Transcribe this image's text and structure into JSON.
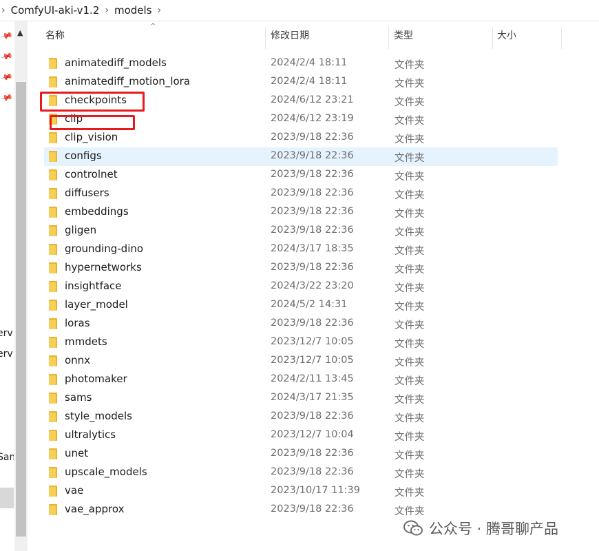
{
  "breadcrumb": {
    "items": [
      "ComfyUI-aki-v1.2",
      "models"
    ]
  },
  "nav_pane": {
    "partial_labels": [
      "erv",
      "erv",
      "Sam"
    ]
  },
  "columns": {
    "name": "名称",
    "date": "修改日期",
    "type": "类型",
    "size": "大小"
  },
  "rows": [
    {
      "name": "animatediff_models",
      "date": "2024/2/4 18:11",
      "type": "文件夹"
    },
    {
      "name": "animatediff_motion_lora",
      "date": "2024/2/4 18:11",
      "type": "文件夹"
    },
    {
      "name": "checkpoints",
      "date": "2024/6/12 23:21",
      "type": "文件夹"
    },
    {
      "name": "clip",
      "date": "2024/6/12 23:19",
      "type": "文件夹"
    },
    {
      "name": "clip_vision",
      "date": "2023/9/18 22:36",
      "type": "文件夹"
    },
    {
      "name": "configs",
      "date": "2023/9/18 22:36",
      "type": "文件夹"
    },
    {
      "name": "controlnet",
      "date": "2023/9/18 22:36",
      "type": "文件夹"
    },
    {
      "name": "diffusers",
      "date": "2023/9/18 22:36",
      "type": "文件夹"
    },
    {
      "name": "embeddings",
      "date": "2023/9/18 22:36",
      "type": "文件夹"
    },
    {
      "name": "gligen",
      "date": "2023/9/18 22:36",
      "type": "文件夹"
    },
    {
      "name": "grounding-dino",
      "date": "2024/3/17 18:35",
      "type": "文件夹"
    },
    {
      "name": "hypernetworks",
      "date": "2023/9/18 22:36",
      "type": "文件夹"
    },
    {
      "name": "insightface",
      "date": "2024/3/22 23:20",
      "type": "文件夹"
    },
    {
      "name": "layer_model",
      "date": "2024/5/2 14:31",
      "type": "文件夹"
    },
    {
      "name": "loras",
      "date": "2023/9/18 22:36",
      "type": "文件夹"
    },
    {
      "name": "mmdets",
      "date": "2023/12/7 10:05",
      "type": "文件夹"
    },
    {
      "name": "onnx",
      "date": "2023/12/7 10:05",
      "type": "文件夹"
    },
    {
      "name": "photomaker",
      "date": "2024/2/11 13:45",
      "type": "文件夹"
    },
    {
      "name": "sams",
      "date": "2024/3/17 21:35",
      "type": "文件夹"
    },
    {
      "name": "style_models",
      "date": "2023/9/18 22:36",
      "type": "文件夹"
    },
    {
      "name": "ultralytics",
      "date": "2023/12/7 10:04",
      "type": "文件夹"
    },
    {
      "name": "unet",
      "date": "2023/9/18 22:36",
      "type": "文件夹"
    },
    {
      "name": "upscale_models",
      "date": "2023/9/18 22:36",
      "type": "文件夹"
    },
    {
      "name": "vae",
      "date": "2023/10/17 11:39",
      "type": "文件夹"
    },
    {
      "name": "vae_approx",
      "date": "2023/9/18 22:36",
      "type": "文件夹"
    }
  ],
  "selected_row": "configs",
  "highlighted_rows": [
    "checkpoints",
    "clip"
  ],
  "colors": {
    "selection": "#e5f3ff",
    "highlight_box": "#e8181c",
    "folder": "#f5c441"
  },
  "watermark": {
    "text": "公众号 · 腾哥聊产品"
  }
}
